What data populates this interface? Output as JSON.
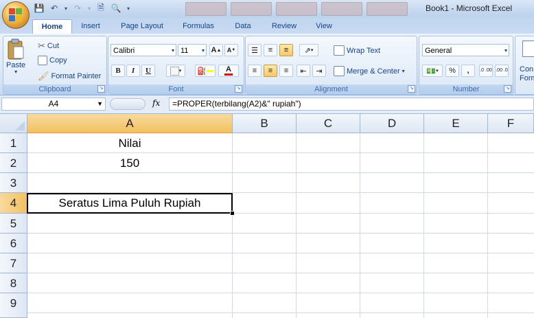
{
  "window": {
    "title": "Book1 - Microsoft Excel"
  },
  "ribbon": {
    "tabs": [
      "Home",
      "Insert",
      "Page Layout",
      "Formulas",
      "Data",
      "Review",
      "View"
    ],
    "active_tab": "Home",
    "clipboard": {
      "paste": "Paste",
      "cut": "Cut",
      "copy": "Copy",
      "format_painter": "Format Painter",
      "label": "Clipboard"
    },
    "font": {
      "name": "Calibri",
      "size": "11",
      "label": "Font",
      "bold": "B",
      "italic": "I",
      "underline": "U",
      "grow": "A",
      "shrink": "A",
      "font_color": "A"
    },
    "alignment": {
      "wrap_text": "Wrap Text",
      "merge_center": "Merge & Center",
      "label": "Alignment"
    },
    "number": {
      "format": "General",
      "label": "Number",
      "percent": "%",
      "comma": ",",
      "inc_decimal": ".0 .00",
      "dec_decimal": ".00 .0"
    },
    "styles": {
      "line1": "Con",
      "line2": "Form"
    }
  },
  "formula_bar": {
    "name_box": "A4",
    "fx": "fx",
    "formula": "=PROPER(terbilang(A2)&\" rupiah\")"
  },
  "sheet": {
    "columns": [
      "A",
      "B",
      "C",
      "D",
      "E",
      "F"
    ],
    "selected_column": "A",
    "rows": [
      "1",
      "2",
      "3",
      "4",
      "5",
      "6",
      "7",
      "8",
      "9"
    ],
    "selected_row": "4",
    "cells": {
      "A1": "Nilai",
      "A2": "150",
      "A3": "",
      "A4": "Seratus Lima Puluh Rupiah"
    }
  },
  "colors": {
    "ribbon_bg": "#dde9f7",
    "selected_header": "#f1c15f",
    "grid_line": "#d0d7e5"
  }
}
